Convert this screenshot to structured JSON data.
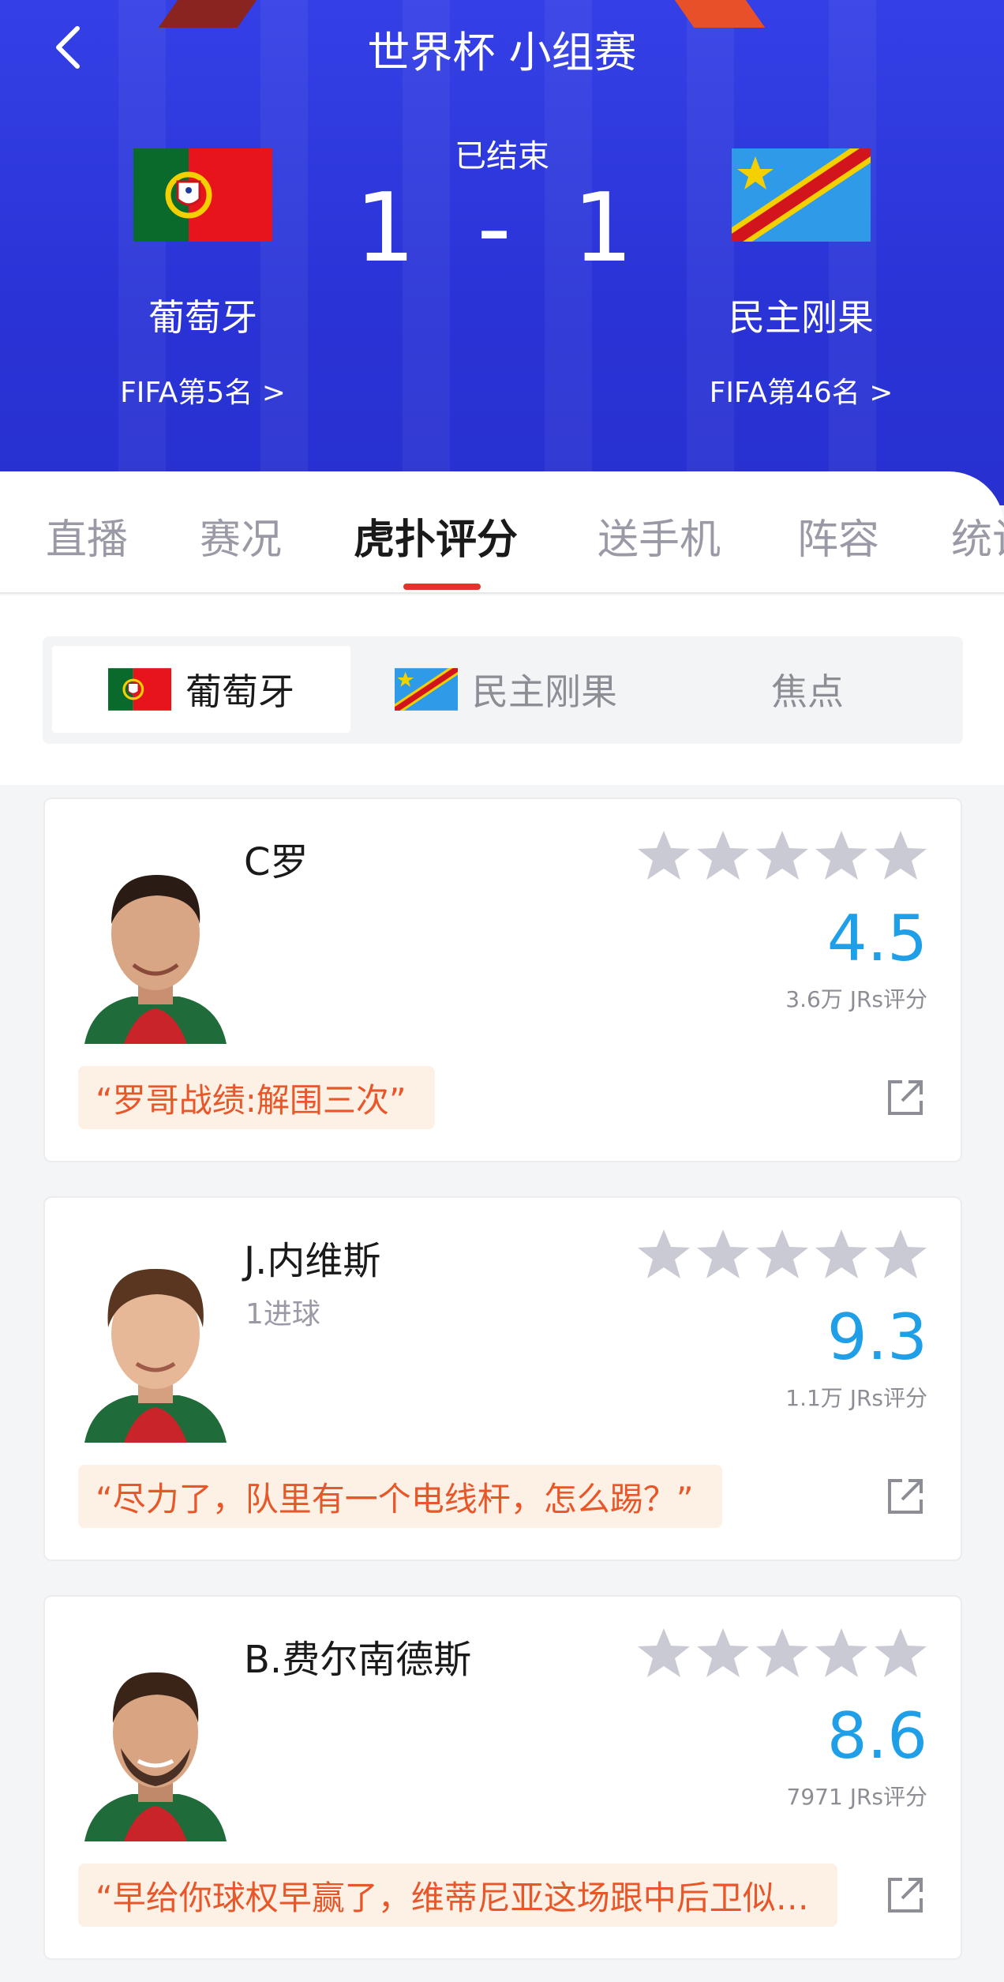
{
  "header": {
    "title": "世界杯 小组赛",
    "status": "已结束",
    "score": "1 - 1",
    "home": {
      "name": "葡萄牙",
      "rank": "FIFA第5名 >"
    },
    "away": {
      "name": "民主刚果",
      "rank": "FIFA第46名 >"
    }
  },
  "tabs": [
    {
      "label": "直播"
    },
    {
      "label": "赛况"
    },
    {
      "label": "虎扑评分"
    },
    {
      "label": "送手机"
    },
    {
      "label": "阵容"
    },
    {
      "label": "统计"
    }
  ],
  "segment": {
    "home": "葡萄牙",
    "away": "民主刚果",
    "focus": "焦点"
  },
  "players": [
    {
      "name": "C罗",
      "note": "",
      "score": "4.5",
      "count": "3.6万 JRs评分",
      "quote": "“罗哥战绩:解围三次”"
    },
    {
      "name": "J.内维斯",
      "note": "1进球",
      "score": "9.3",
      "count": "1.1万 JRs评分",
      "quote": "“尽力了，队里有一个电线杆，怎么踢？”"
    },
    {
      "name": "B.费尔南德斯",
      "note": "",
      "score": "8.6",
      "count": "7971 JRs评分",
      "quote": "“早给你球权早赢了，维蒂尼亚这场跟中后卫似…"
    }
  ],
  "colors": {
    "accent": "#e8312a",
    "score_blue": "#1f9fe8",
    "header_blue": "#2f3ae0",
    "quote_text": "#e8572a"
  }
}
